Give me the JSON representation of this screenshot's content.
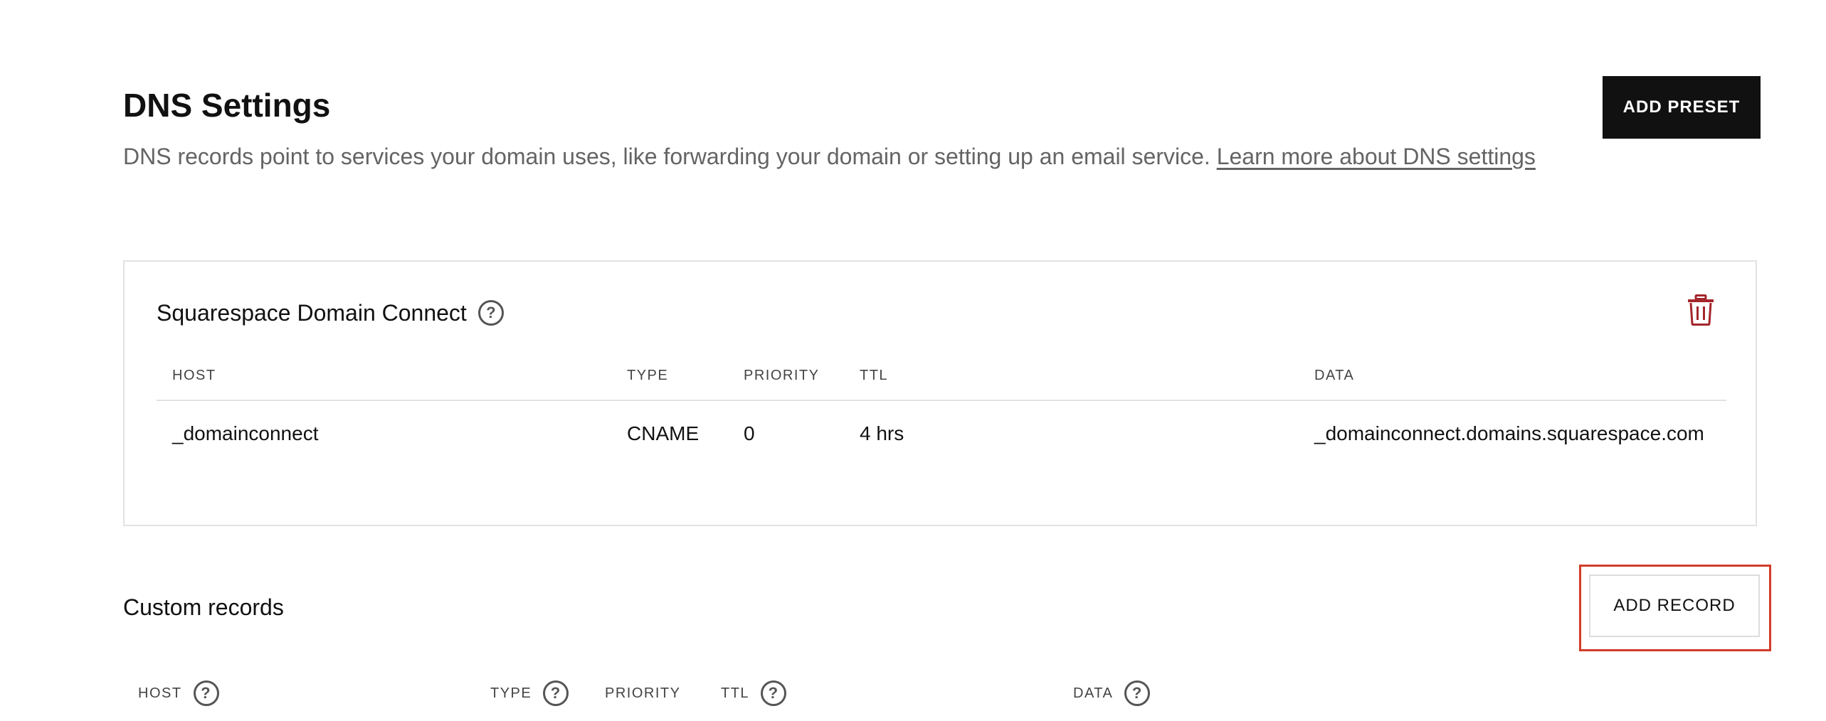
{
  "header": {
    "title": "DNS Settings",
    "description": "DNS records point to services your domain uses, like forwarding your domain or setting up an email service.",
    "learn_more_link": "Learn more about DNS settings",
    "add_preset_label": "ADD PRESET"
  },
  "domain_connect": {
    "title": "Squarespace Domain Connect",
    "columns": [
      "HOST",
      "TYPE",
      "PRIORITY",
      "TTL",
      "DATA"
    ],
    "rows": [
      {
        "host": "_domainconnect",
        "type": "CNAME",
        "priority": "0",
        "ttl": "4 hrs",
        "data": "_domainconnect.domains.squarespace.com"
      }
    ]
  },
  "custom_records": {
    "title": "Custom records",
    "add_record_label": "ADD RECORD",
    "columns": [
      "HOST",
      "TYPE",
      "PRIORITY",
      "TTL",
      "DATA"
    ]
  },
  "icons": {
    "help": "question-circle-icon",
    "delete": "trash-icon"
  },
  "colors": {
    "delete_red": "#a4262c",
    "highlight_red": "#d23c28",
    "button_dark": "#111111"
  }
}
